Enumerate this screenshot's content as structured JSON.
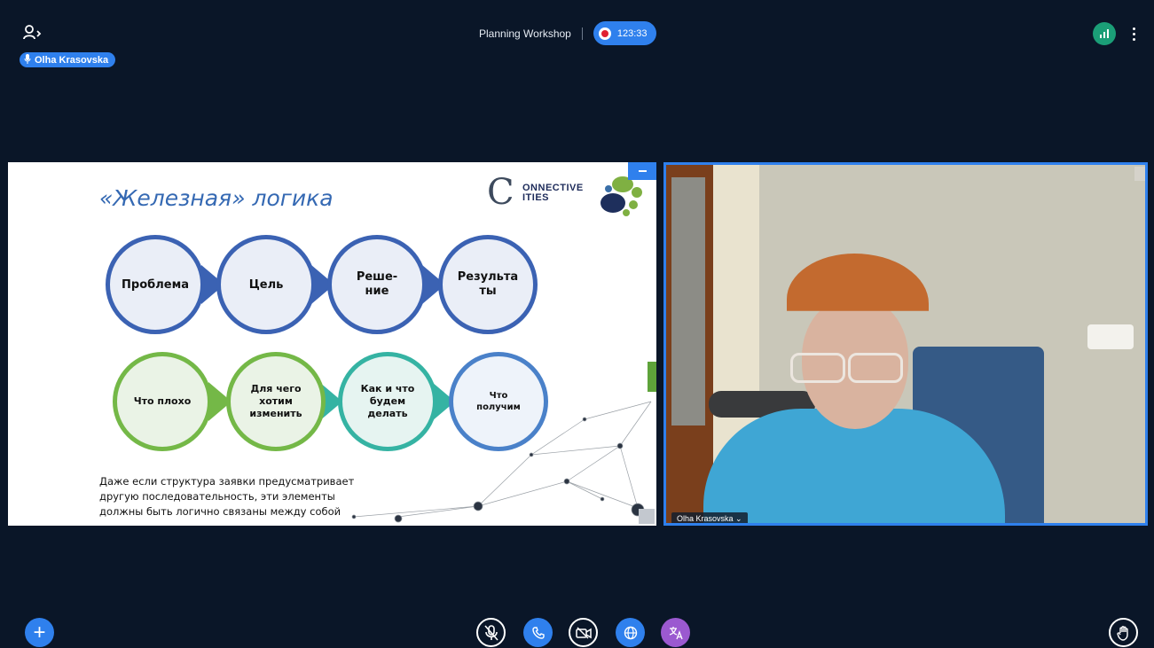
{
  "topbar": {
    "meeting_title": "Planning Workshop",
    "recording_time": "123:33",
    "speaker_name": "Olha Krasovska",
    "icons": [
      "users-icon",
      "microphone-icon",
      "record-icon",
      "connection-status-icon",
      "more-options-icon"
    ]
  },
  "slide": {
    "title": "«Железная» логика",
    "logo_text": "ONNECTIVE ITIES",
    "logo_letter": "C",
    "row1": [
      "Проблема",
      "Цель",
      "Реше-\nние",
      "Результа\nты"
    ],
    "row2": [
      "Что плохо",
      "Для чего\nхотим\nизменить",
      "Как и что\nбудем\nделать",
      "Что\nполучим"
    ],
    "footer_text": "Даже если структура заявки предусматривает другую последовательность, эти элементы должны быть логично связаны между собой",
    "colors": {
      "title": "#3569b3",
      "row1_border": "#3b62b3",
      "green": "#74b847",
      "teal": "#35b3a3",
      "azure": "#4a81c9"
    }
  },
  "webcam": {
    "participant_name": "Olha Krasovska"
  },
  "controls": {
    "icons": [
      "plus-icon",
      "mute-microphone-icon",
      "phone-icon",
      "camera-off-icon",
      "globe-icon",
      "translate-icon",
      "raise-hand-icon"
    ]
  },
  "theme": {
    "background": "#0a1628",
    "accent": "#2f80ed"
  }
}
